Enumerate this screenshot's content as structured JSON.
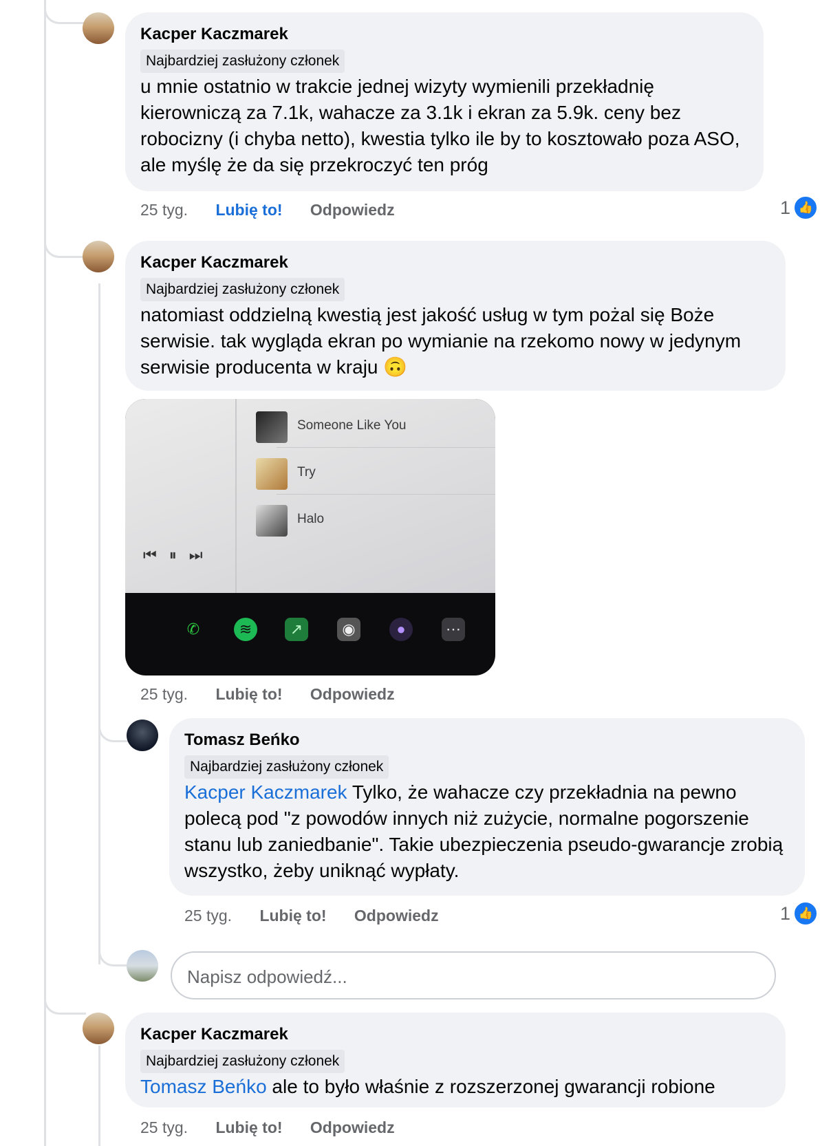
{
  "comments": [
    {
      "author": "Kacper Kaczmarek",
      "badge": "Najbardziej zasłużony członek",
      "text": "u mnie ostatnio w trakcie jednej wizyty wymienili przekładnię kierowniczą za 7.1k, wahacze za 3.1k i ekran za 5.9k. ceny bez robocizny (i chyba netto), kwestia tylko ile by to kosztowało poza ASO, ale myślę że da się przekroczyć ten próg",
      "time": "25 tyg.",
      "like_label": "Lubię to!",
      "reply_label": "Odpowiedz",
      "reaction_count": "1"
    },
    {
      "author": "Kacper Kaczmarek",
      "badge": "Najbardziej zasłużony członek",
      "text": "natomiast oddzielną kwestią jest jakość usług w tym pożal się Boże serwisie. tak wygląda ekran po wymianie na rzekomo nowy w jedynym serwisie producenta w kraju 🙃",
      "time": "25 tyg.",
      "like_label": "Lubię to!",
      "reply_label": "Odpowiedz",
      "photo": {
        "songs": [
          "Someone Like You",
          "Try",
          "Halo"
        ]
      }
    },
    {
      "author": "Tomasz Beńko",
      "badge": "Najbardziej zasłużony członek",
      "mention": "Kacper Kaczmarek",
      "text": " Tylko, że wahacze czy przekładnia na pewno polecą pod \"z powodów innych niż zużycie, normalne pogorszenie stanu lub zaniedbanie\". Takie ubezpieczenia pseudo-gwarancje zrobią wszystko, żeby uniknąć wypłaty.",
      "time": "25 tyg.",
      "like_label": "Lubię to!",
      "reply_label": "Odpowiedz",
      "reaction_count": "1"
    },
    {
      "author": "Kacper Kaczmarek",
      "badge": "Najbardziej zasłużony członek",
      "mention": "Tomasz Beńko",
      "text": " ale to było właśnie z rozszerzonej gwarancji robione",
      "time": "25 tyg.",
      "like_label": "Lubię to!",
      "reply_label": "Odpowiedz"
    }
  ],
  "reply_input": {
    "placeholder": "Napisz odpowiedź..."
  },
  "icons": {
    "like": "thumbs-up-icon"
  },
  "colors": {
    "link": "#1a6ed8",
    "bubble": "#f0f2f5",
    "like_blue": "#1877f2"
  }
}
